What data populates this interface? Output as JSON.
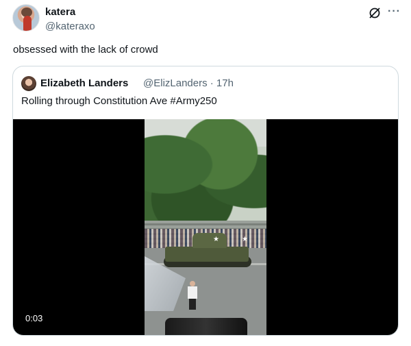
{
  "post": {
    "author_name": "katera",
    "author_handle": "@kateraxo",
    "text": "obsessed with the lack of crowd",
    "more_label": "···"
  },
  "quote": {
    "author_name": "Elizabeth Landers",
    "meta": "@ElizLanders · 17h",
    "text": "Rolling through Constitution Ave #Army250",
    "video": {
      "timestamp": "0:03"
    }
  },
  "icons": {
    "grok": "grok-icon",
    "more": "more-icon"
  },
  "colors": {
    "text_primary": "#0f1419",
    "text_secondary": "#536471",
    "border": "#cfd9de"
  }
}
